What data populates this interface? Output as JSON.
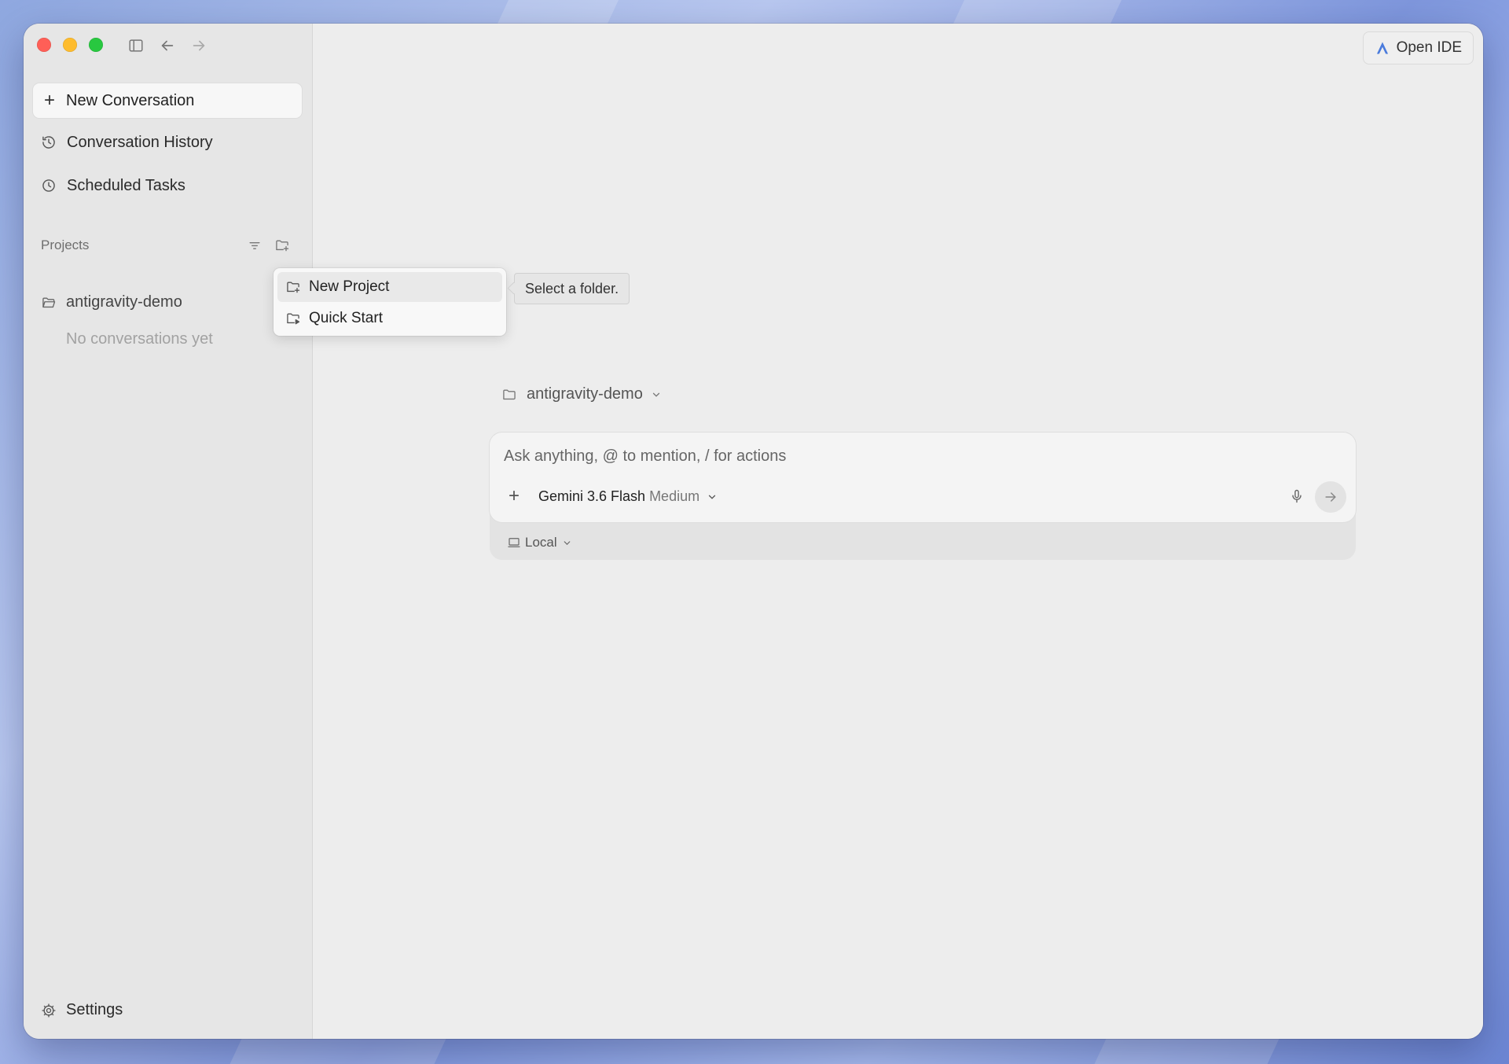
{
  "sidebar": {
    "new_conversation": "New Conversation",
    "nav": [
      {
        "label": "Conversation History",
        "icon": "history-icon"
      },
      {
        "label": "Scheduled Tasks",
        "icon": "clock-icon"
      }
    ],
    "projects_header": "Projects",
    "project": {
      "name": "antigravity-demo",
      "empty": "No conversations yet"
    },
    "settings": "Settings"
  },
  "header": {
    "open_ide": "Open IDE"
  },
  "context_menu": {
    "items": [
      {
        "label": "New Project",
        "icon": "new-folder-icon"
      },
      {
        "label": "Quick Start",
        "icon": "folder-play-icon"
      }
    ],
    "tooltip": "Select a folder."
  },
  "composer": {
    "project": "antigravity-demo",
    "placeholder": "Ask anything, @ to mention, / for actions",
    "model": "Gemini 3.6 Flash",
    "effort": "Medium",
    "environment": "Local"
  },
  "colors": {
    "close": "#ff5f57",
    "minimize": "#febc2e",
    "maximize": "#28c840",
    "accent": "#4a7bdc"
  }
}
